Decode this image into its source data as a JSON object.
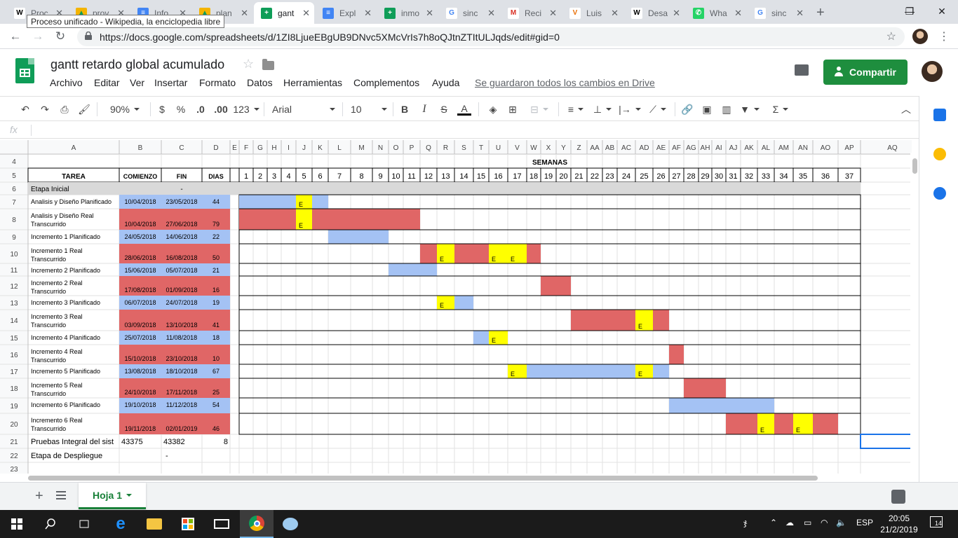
{
  "browser": {
    "tabs": [
      {
        "label": "Proc",
        "fav": "W",
        "color": "#ffffff",
        "fg": "#000"
      },
      {
        "label": "prov",
        "fav": "▲",
        "color": "#f4b400",
        "fg": "#0f9d58"
      },
      {
        "label": "Info",
        "fav": "≡",
        "color": "#4285f4",
        "fg": "#fff"
      },
      {
        "label": "plan",
        "fav": "▲",
        "color": "#f4b400",
        "fg": "#0f9d58"
      },
      {
        "label": "gant",
        "fav": "+",
        "color": "#0f9d58",
        "fg": "#fff"
      },
      {
        "label": "Expl",
        "fav": "≡",
        "color": "#4285f4",
        "fg": "#fff"
      },
      {
        "label": "inmo",
        "fav": "+",
        "color": "#0f9d58",
        "fg": "#fff"
      },
      {
        "label": "sinc",
        "fav": "G",
        "color": "#ffffff",
        "fg": "#4285f4"
      },
      {
        "label": "Reci",
        "fav": "M",
        "color": "#ffffff",
        "fg": "#d93025"
      },
      {
        "label": "Luis",
        "fav": "V",
        "color": "#ffffff",
        "fg": "#e8710a"
      },
      {
        "label": "Desa",
        "fav": "W",
        "color": "#ffffff",
        "fg": "#000"
      },
      {
        "label": "Wha",
        "fav": "✆",
        "color": "#25d366",
        "fg": "#fff"
      },
      {
        "label": "sinc",
        "fav": "G",
        "color": "#ffffff",
        "fg": "#4285f4"
      }
    ],
    "tooltip": "Proceso unificado - Wikipedia, la enciclopedia libre",
    "url": "https://docs.google.com/spreadsheets/d/1ZI8LjueEBgUB9DNvc5XMcVrIs7h8oQJtnZTItULJqds/edit#gid=0",
    "new_tab": "+",
    "win": {
      "min": "—",
      "max": "❐",
      "close": "✕"
    }
  },
  "doc": {
    "title": "gantt retardo global acumulado",
    "menus": [
      "Archivo",
      "Editar",
      "Ver",
      "Insertar",
      "Formato",
      "Datos",
      "Herramientas",
      "Complementos",
      "Ayuda"
    ],
    "saved": "Se guardaron todos los cambios en Drive",
    "share": "Compartir"
  },
  "toolbar": {
    "zoom": "90%",
    "currency": "$",
    "percent": "%",
    "dec_less": ".0",
    "dec_more": ".00",
    "format": "123",
    "font": "Arial",
    "size": "10",
    "bold": "B",
    "italic": "I",
    "strike": "S",
    "text_color": "A",
    "sum": "Σ"
  },
  "fx": "fx",
  "sheet": {
    "col_letters": [
      "A",
      "B",
      "C",
      "D",
      "E",
      "F",
      "G",
      "H",
      "I",
      "J",
      "K",
      "L",
      "M",
      "N",
      "O",
      "P",
      "Q",
      "R",
      "S",
      "T",
      "U",
      "V",
      "W",
      "X",
      "Y",
      "Z",
      "AA",
      "AB",
      "AC",
      "AD",
      "AE",
      "AF",
      "AG",
      "AH",
      "AI",
      "AJ",
      "AK",
      "AL",
      "AM",
      "AN",
      "AO",
      "AP",
      "AQ"
    ],
    "row_numbers": [
      "4",
      "5",
      "6",
      "7",
      "8",
      "9",
      "10",
      "11",
      "12",
      "13",
      "14",
      "15",
      "16",
      "17",
      "18",
      "19",
      "20",
      "21",
      "22",
      "23"
    ],
    "semanas": "SEMANAS",
    "headers": {
      "tarea": "TAREA",
      "comienzo": "COMIENZO",
      "fin": "FIN",
      "dias": "DIAS"
    },
    "weeks": [
      "1",
      "2",
      "3",
      "4",
      "5",
      "6",
      "7",
      "8",
      "9",
      "10",
      "11",
      "12",
      "13",
      "14",
      "15",
      "16",
      "17",
      "18",
      "19",
      "20",
      "21",
      "22",
      "23",
      "24",
      "25",
      "26",
      "27",
      "28",
      "29",
      "30",
      "31",
      "32",
      "33",
      "34",
      "35",
      "36",
      "37"
    ],
    "etapa_inicial": "Etapa Inicial",
    "etapa_dash": "-",
    "tasks": [
      {
        "name": "Analisis y Diseño Planificado",
        "start": "10/04/2018",
        "end": "23/05/2018",
        "days": "44",
        "kind": "plan",
        "from": 1,
        "to": 6,
        "e": [
          5
        ]
      },
      {
        "name": "Analisis y Diseño Real Transcurrido",
        "start": "10/04/2018",
        "end": "27/06/2018",
        "days": "79",
        "kind": "real",
        "from": 1,
        "to": 11,
        "e": [
          5
        ]
      },
      {
        "name": "Incremento 1 Planificado",
        "start": "24/05/2018",
        "end": "14/06/2018",
        "days": "22",
        "kind": "plan",
        "from": 7,
        "to": 9,
        "e": []
      },
      {
        "name": "Incremento 1 Real Transcurrido",
        "start": "28/06/2018",
        "end": "16/08/2018",
        "days": "50",
        "kind": "real",
        "from": 12,
        "to": 18,
        "e": [
          13,
          16,
          17
        ]
      },
      {
        "name": "Incremento 2 Planificado",
        "start": "15/06/2018",
        "end": "05/07/2018",
        "days": "21",
        "kind": "plan",
        "from": 10,
        "to": 12,
        "e": []
      },
      {
        "name": "Incremento 2 Real Transcurrido",
        "start": "17/08/2018",
        "end": "01/09/2018",
        "days": "16",
        "kind": "real",
        "from": 19,
        "to": 20,
        "e": []
      },
      {
        "name": "Incremento 3 Planificado",
        "start": "06/07/2018",
        "end": "24/07/2018",
        "days": "19",
        "kind": "plan",
        "from": 13,
        "to": 14,
        "e": [
          13
        ]
      },
      {
        "name": "Incremento 3 Real Transcurrido",
        "start": "03/09/2018",
        "end": "13/10/2018",
        "days": "41",
        "kind": "real",
        "from": 21,
        "to": 26,
        "e": [
          25
        ]
      },
      {
        "name": "Incremento 4 Planificado",
        "start": "25/07/2018",
        "end": "11/08/2018",
        "days": "18",
        "kind": "plan",
        "from": 15,
        "to": 16,
        "e": [
          16
        ]
      },
      {
        "name": "Incremento 4 Real Transcurrido",
        "start": "15/10/2018",
        "end": "23/10/2018",
        "days": "10",
        "kind": "real",
        "from": 27,
        "to": 27,
        "e": []
      },
      {
        "name": "Incremento 5 Planificado",
        "start": "13/08/2018",
        "end": "18/10/2018",
        "days": "67",
        "kind": "plan",
        "from": 17,
        "to": 26,
        "e": [
          17,
          25
        ]
      },
      {
        "name": "Incremento 5 Real Transcurrido",
        "start": "24/10/2018",
        "end": "17/11/2018",
        "days": "25",
        "kind": "real",
        "from": 28,
        "to": 30,
        "e": []
      },
      {
        "name": "Incremento 6 Planificado",
        "start": "19/10/2018",
        "end": "11/12/2018",
        "days": "54",
        "kind": "plan",
        "from": 27,
        "to": 33,
        "e": []
      },
      {
        "name": "Incremento 6 Real Transcurrido",
        "start": "19/11/2018",
        "end": "02/01/2019",
        "days": "46",
        "kind": "real",
        "from": 31,
        "to": 36,
        "e": [
          33,
          35
        ]
      }
    ],
    "e_label": "E",
    "row22": {
      "name": "Pruebas Integral del sist",
      "start": "43375",
      "end": "43382",
      "days": "8"
    },
    "row23": {
      "name": "Etapa de Despliegue",
      "start": "-"
    },
    "colors": {
      "plan": "#a4c2f4",
      "real": "#e06666",
      "hito": "#ffff00",
      "band": "#d9d9d9",
      "header_bg": "#f8f9fa",
      "select": "#1a73e8"
    }
  },
  "sheet_tab": "Hoja 1",
  "taskbar": {
    "lang": "ESP",
    "time": "20:05",
    "date": "21/2/2019",
    "notif": "14"
  }
}
